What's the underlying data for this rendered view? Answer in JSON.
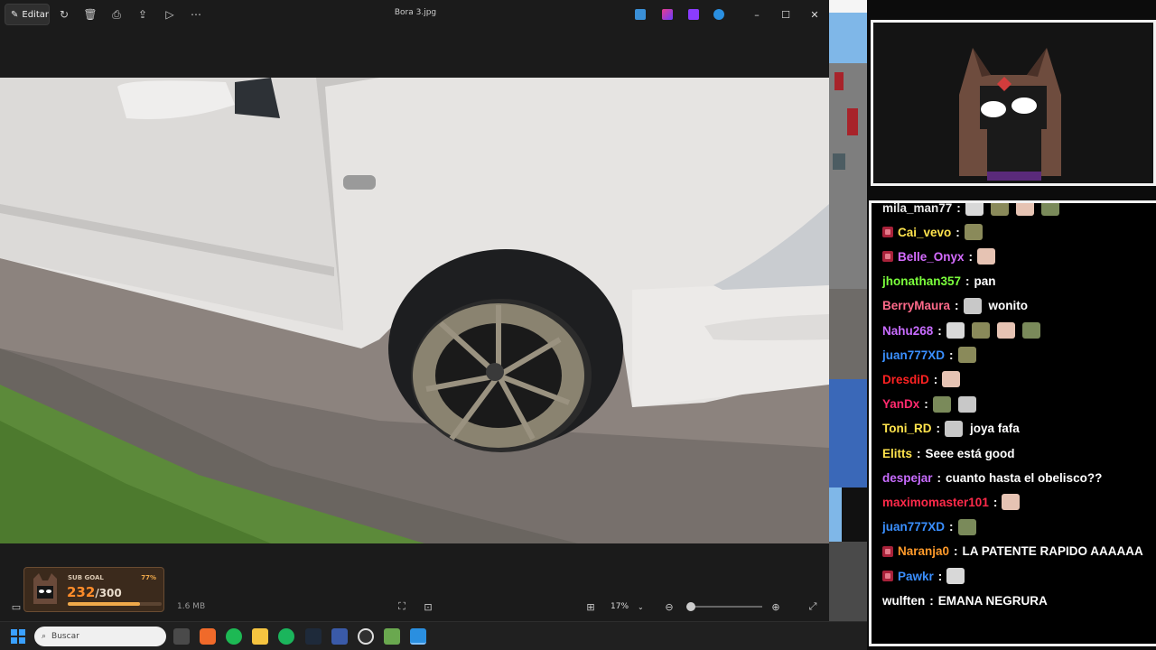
{
  "viewer": {
    "title": "Bora 3.jpg",
    "edit_label": "Editar",
    "file_size": "1.6 MB",
    "zoom": "17%",
    "zoom_level": 0.0
  },
  "subgoal": {
    "label": "SUB GOAL",
    "percent": "77%",
    "current": "232",
    "total": "/300",
    "progress": 0.77
  },
  "chat": {
    "messages": [
      {
        "user": "mila_man77",
        "color": "#e9e9e9",
        "badge": false,
        "emotes": 4,
        "text": ""
      },
      {
        "user": "Cai_vevo",
        "color": "#ffe44d",
        "badge": true,
        "emotes": 1,
        "text": ""
      },
      {
        "user": "Belle_Onyx",
        "color": "#d56cff",
        "badge": true,
        "emotes": 1,
        "text": ""
      },
      {
        "user": "jhonathan357",
        "color": "#7bff3c",
        "badge": false,
        "emotes": 0,
        "text": "pan"
      },
      {
        "user": "BerryMaura",
        "color": "#ff6a8a",
        "badge": false,
        "emotes": 1,
        "text": "wonito"
      },
      {
        "user": "Nahu268",
        "color": "#c86cff",
        "badge": false,
        "emotes": 4,
        "text": ""
      },
      {
        "user": "juan777XD",
        "color": "#3a8fff",
        "badge": false,
        "emotes": 1,
        "text": ""
      },
      {
        "user": "DresdiD",
        "color": "#ff2222",
        "badge": false,
        "emotes": 1,
        "text": ""
      },
      {
        "user": "YanDx",
        "color": "#ff2a6e",
        "badge": false,
        "emotes": 2,
        "text": ""
      },
      {
        "user": "Toni_RD",
        "color": "#ffe44d",
        "badge": false,
        "emotes": 1,
        "text": "joya fafa"
      },
      {
        "user": "Elitts",
        "color": "#ffe44d",
        "badge": false,
        "emotes": 0,
        "text": "Seee está good"
      },
      {
        "user": "despejar",
        "color": "#c86cff",
        "badge": false,
        "emotes": 0,
        "text": "cuanto hasta el obelisco??"
      },
      {
        "user": "maximomaster101",
        "color": "#ff2a4a",
        "badge": false,
        "emotes": 1,
        "text": ""
      },
      {
        "user": "juan777XD",
        "color": "#3a8fff",
        "badge": false,
        "emotes": 1,
        "text": ""
      },
      {
        "user": "Naranja0",
        "color": "#ff9a2a",
        "badge": true,
        "emotes": 0,
        "text": "LA PATENTE RAPIDO AAAAAA"
      },
      {
        "user": "Pawkr",
        "color": "#3a8fff",
        "badge": true,
        "emotes": 1,
        "text": ""
      },
      {
        "user": "wulften",
        "color": "#ffffff",
        "badge": false,
        "emotes": 0,
        "text": "EMANA NEGRURA"
      }
    ]
  },
  "taskbar": {
    "search_placeholder": "Buscar"
  }
}
